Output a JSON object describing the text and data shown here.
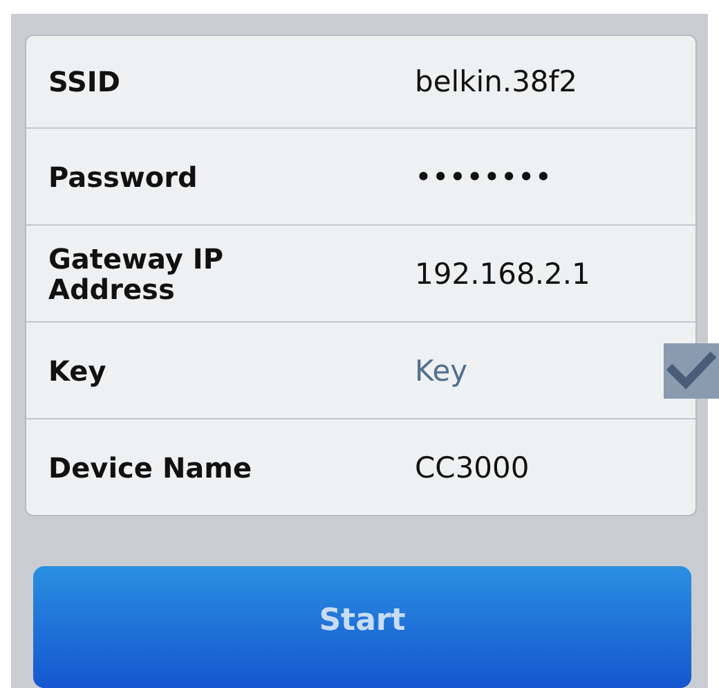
{
  "form": {
    "rows": [
      {
        "label": "SSID",
        "value": "belkin.38f2"
      },
      {
        "label": "Password",
        "value": "••••••••"
      },
      {
        "label": "Gateway IP Address",
        "value": "192.168.2.1"
      },
      {
        "label": "Key",
        "placeholder": "Key",
        "checked": true
      },
      {
        "label": "Device Name",
        "value": "CC3000"
      }
    ]
  },
  "buttons": [
    {
      "label": "Start"
    }
  ]
}
